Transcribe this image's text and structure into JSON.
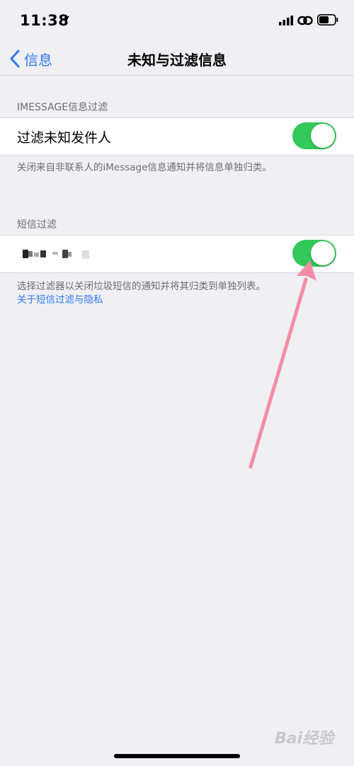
{
  "status": {
    "time": "11:38"
  },
  "nav": {
    "back_label": "信息",
    "title": "未知与过滤信息"
  },
  "imessage_section": {
    "header": "IMESSAGE信息过滤",
    "row_label": "过滤未知发件人",
    "toggle_on": true,
    "footer": "关闭来自非联系人的iMessage信息通知并将信息单独归类。"
  },
  "sms_section": {
    "header": "短信过滤",
    "toggle_on": true,
    "footer": "选择过滤器以关闭垃圾短信的通知并将其归类到单独列表。",
    "footer_link": "关于短信过滤与隐私"
  },
  "watermark": {
    "text": "Bai经验"
  },
  "colors": {
    "accent": "#3478f6",
    "toggle_on": "#34c759",
    "background": "#efeff4",
    "arrow": "#f48ca6"
  }
}
